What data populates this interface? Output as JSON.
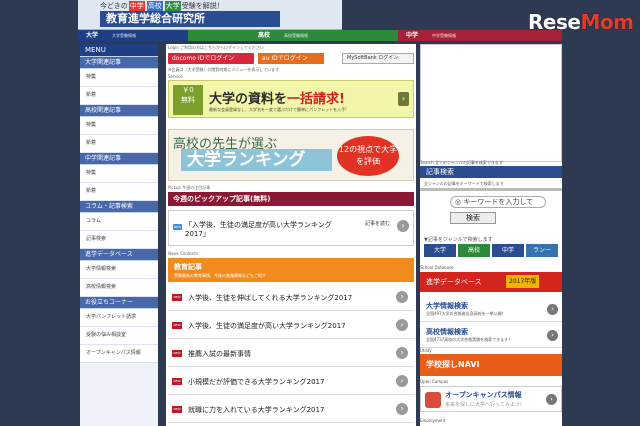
{
  "header": {
    "tagline_prefix": "今どきの",
    "tagline_tags": [
      {
        "text": "中学",
        "color": "#e23b2e"
      },
      {
        "text": "高校",
        "color": "#3a6fc1"
      },
      {
        "text": "大学",
        "color": "#2b8e44"
      }
    ],
    "tagline_suffix": "受験を解説！",
    "site_title": "教育進学総合研究所",
    "logo_main": "Rese",
    "logo_accent": "Mom"
  },
  "nav": {
    "tabs": [
      {
        "label": "大学",
        "sub": "大学受験情報",
        "color": "#1f3f85"
      },
      {
        "label": "高校",
        "sub": "高校受験情報",
        "color": "#2c8b3a"
      },
      {
        "label": "中学",
        "sub": "中学受験情報",
        "color": "#a52338"
      }
    ]
  },
  "sidebar": {
    "menu_title": "MENU",
    "sections": [
      {
        "title": "大学関連記事",
        "items": [
          "特集",
          "新着"
        ]
      },
      {
        "title": "高校関連記事",
        "items": [
          "特集",
          "新着"
        ]
      },
      {
        "title": "中学関連記事",
        "items": [
          "特集",
          "新着"
        ]
      },
      {
        "title": "コラム・記事検索",
        "items": [
          "コラム",
          "記事検索"
        ]
      },
      {
        "title": "進学データベース",
        "items": [
          "大学情報検索",
          "高校情報検索"
        ]
      },
      {
        "title": "お役立ちコーナー",
        "items": [
          "大学パンフレット請求",
          "受験の悩み相談室",
          "オープンキャンパス情報"
        ]
      }
    ]
  },
  "login": {
    "label": "Login ご利用の方はこちらからログインしてください",
    "docomo": "docomo IDでログイン",
    "au": "au IDでログイン",
    "softbank": "MySoftBank ログイン",
    "note": "※会員は『大学受験』の閲覧時期にメニューを表示しています"
  },
  "banners": {
    "label": "Service",
    "b1_yen_top": "￥0",
    "b1_yen_bottom": "無料",
    "b1_head_a": "大学の資料を",
    "b1_head_red": "一括請求!",
    "b1_sub": "最新な会員登録なし、大学名を一度で選ぶだけで簡単にパンフレットを入手!",
    "b2_line1": "高校の先生が選ぶ",
    "b2_line2": "大学ランキング",
    "b2_badge": "12の視点で大学を評価"
  },
  "pickup": {
    "label": "Pickup 今週の注目記事",
    "title": "今週のピックアップ記事(無料)",
    "new": "NEW",
    "article": "「入学後、生徒の満足度が高い大学ランキング2017」",
    "read_more": "記事を読む"
  },
  "education": {
    "label": "News Contents",
    "title": "教育記事",
    "sub": "受験最新の教育事情、今後の進路情報などをご紹介",
    "new": "NEW",
    "articles": [
      "入学後、生徒を伸ばしてくれる大学ランキング2017",
      "入学後、生徒の満足度が高い大学ランキング2017",
      "推薦入試の最新事情",
      "小規模だが評価できる大学ランキング2017",
      "就職に力を入れている大学ランキング2017"
    ]
  },
  "right": {
    "search_label": "Search 全てのジャンルの記事を検索できます",
    "search_title": "記事検索",
    "search_desc": "全ジャンルの記事をキーワードで検索します",
    "kw_placeholder": "キーワードを入力して",
    "kw_button": "検索",
    "genre_label": "▼記事をジャンルで検索します",
    "genre_tabs": [
      "大学",
      "高校",
      "中学",
      "ランー"
    ],
    "db_label": "School Database",
    "db_title": "進学データベース",
    "db_year": "2017年版",
    "db_rows": [
      {
        "title": "大学情報検索",
        "sub": "全国497大学の合格者出身高校を一挙公開！"
      },
      {
        "title": "高校情報検索",
        "sub": "全国4737高校の大学合格実績を検索できます！"
      }
    ],
    "navi_label": "Utility",
    "navi_title": "学校探しNAVI",
    "oc_label": "Open Campus",
    "oc_title": "オープンキャンパス情報",
    "oc_sub": "未来を探しに大学へ行ってみよう！",
    "employment_label": "Employment"
  }
}
